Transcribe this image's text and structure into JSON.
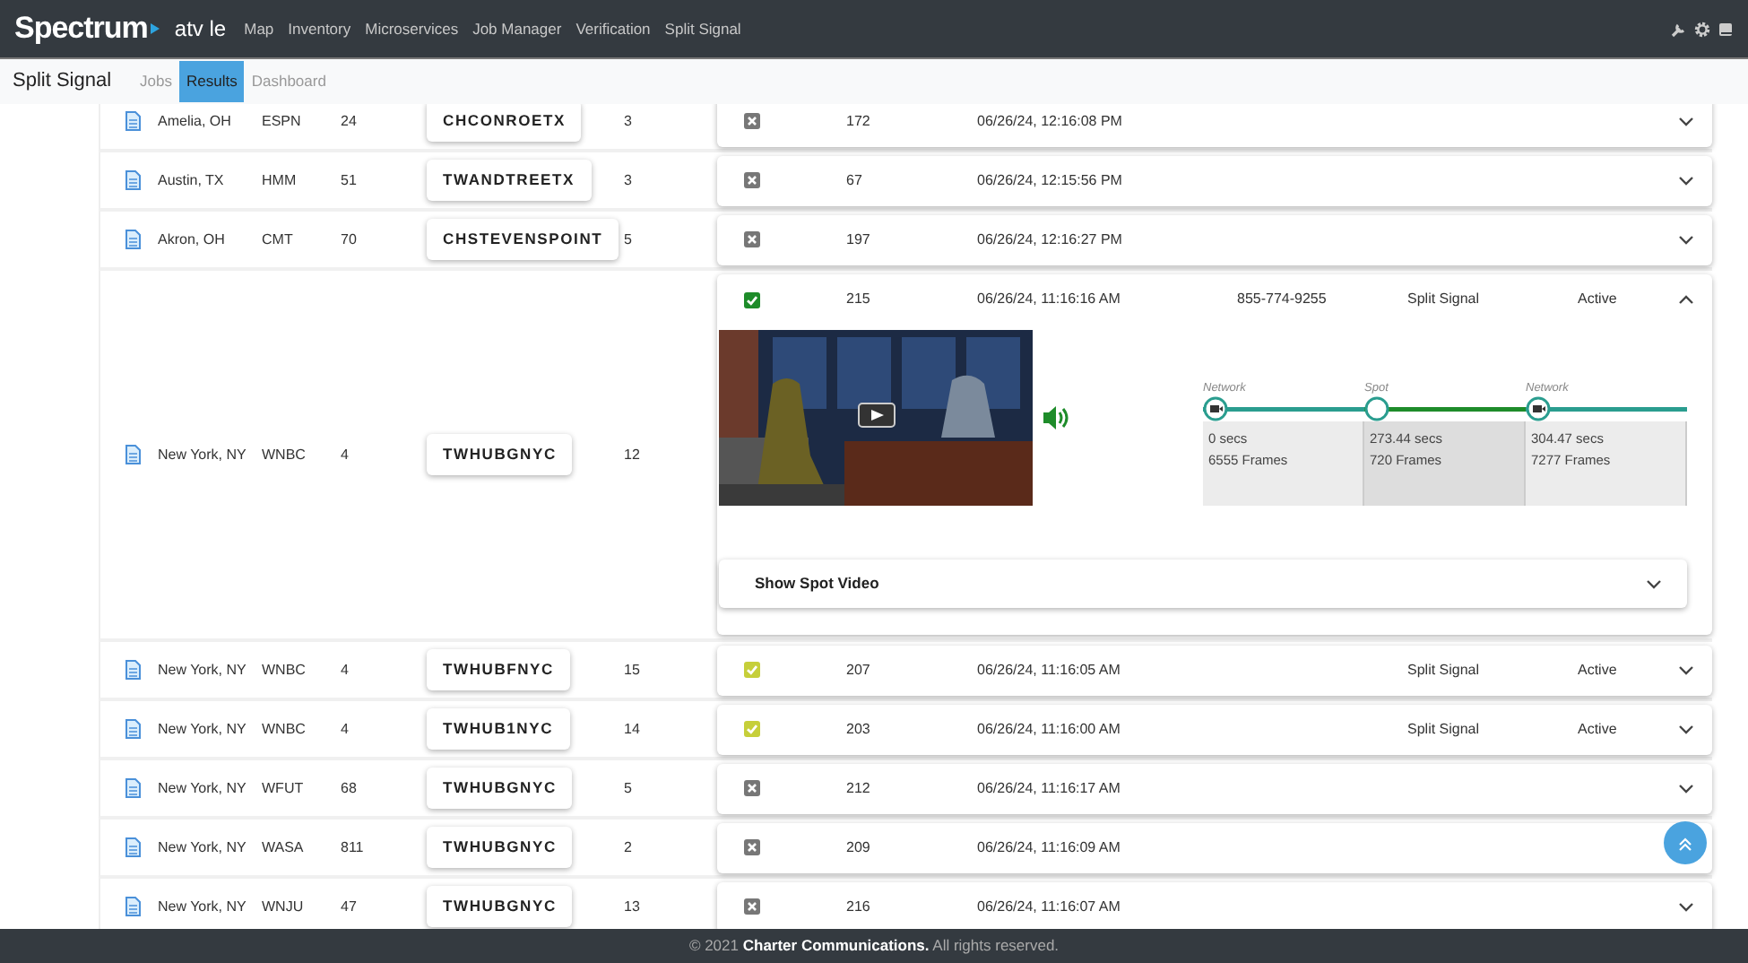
{
  "navbar": {
    "brand": "Spectrum",
    "app": "atv le",
    "links": [
      "Map",
      "Inventory",
      "Microservices",
      "Job Manager",
      "Verification",
      "Split Signal"
    ]
  },
  "subnav": {
    "title": "Split Signal",
    "tabs": [
      {
        "label": "Jobs",
        "selected": false
      },
      {
        "label": "Results",
        "selected": true
      },
      {
        "label": "Dashboard",
        "selected": false
      }
    ]
  },
  "rows": [
    {
      "location": "Amelia, OH",
      "network": "ESPN",
      "channel": "24",
      "zone": "CHCONROETX",
      "count": "3",
      "kind": "fail",
      "id": "172",
      "time": "06/26/24, 12:16:08 PM",
      "expanded": false
    },
    {
      "location": "Austin, TX",
      "network": "HMM",
      "channel": "51",
      "zone": "TWANDTREETX",
      "count": "3",
      "kind": "fail",
      "id": "67",
      "time": "06/26/24, 12:15:56 PM",
      "expanded": false
    },
    {
      "location": "Akron, OH",
      "network": "CMT",
      "channel": "70",
      "zone": "CHSTEVENSPOINT",
      "count": "5",
      "kind": "fail",
      "id": "197",
      "time": "06/26/24, 12:16:27 PM",
      "expanded": false
    },
    {
      "location": "New York, NY",
      "network": "WNBC",
      "channel": "4",
      "zone": "TWHUBGNYC",
      "count": "12",
      "kind": "pass",
      "id": "215",
      "time": "06/26/24, 11:16:16 AM",
      "phone": "855-774-9255",
      "type": "Split Signal",
      "state": "Active",
      "expanded": true,
      "detail": {
        "timeline": [
          {
            "label": "Network",
            "kind": "network",
            "time": "0 secs",
            "frames": "6555 Frames"
          },
          {
            "label": "Spot",
            "kind": "spot",
            "time": "273.44 secs",
            "frames": "720 Frames"
          },
          {
            "label": "Network",
            "kind": "network",
            "time": "304.47 secs",
            "frames": "7277 Frames"
          }
        ],
        "toggle": "Show Spot Video"
      }
    },
    {
      "location": "New York, NY",
      "network": "WNBC",
      "channel": "4",
      "zone": "TWHUBFNYC",
      "count": "15",
      "kind": "warn",
      "id": "207",
      "time": "06/26/24, 11:16:05 AM",
      "type": "Split Signal",
      "state": "Active",
      "expanded": false
    },
    {
      "location": "New York, NY",
      "network": "WNBC",
      "channel": "4",
      "zone": "TWHUB1NYC",
      "count": "14",
      "kind": "warn",
      "id": "203",
      "time": "06/26/24, 11:16:00 AM",
      "type": "Split Signal",
      "state": "Active",
      "expanded": false
    },
    {
      "location": "New York, NY",
      "network": "WFUT",
      "channel": "68",
      "zone": "TWHUBGNYC",
      "count": "5",
      "kind": "fail",
      "id": "212",
      "time": "06/26/24, 11:16:17 AM",
      "expanded": false
    },
    {
      "location": "New York, NY",
      "network": "WASA",
      "channel": "811",
      "zone": "TWHUBGNYC",
      "count": "2",
      "kind": "fail",
      "id": "209",
      "time": "06/26/24, 11:16:09 AM"
    },
    {
      "location": "New York, NY",
      "network": "WNJU",
      "channel": "47",
      "zone": "TWHUBGNYC",
      "count": "13",
      "kind": "fail",
      "id": "216",
      "time": "06/26/24, 11:16:07 AM",
      "expanded": false
    }
  ],
  "footer": "© 2021 **Charter Communications.** All rights reserved."
}
